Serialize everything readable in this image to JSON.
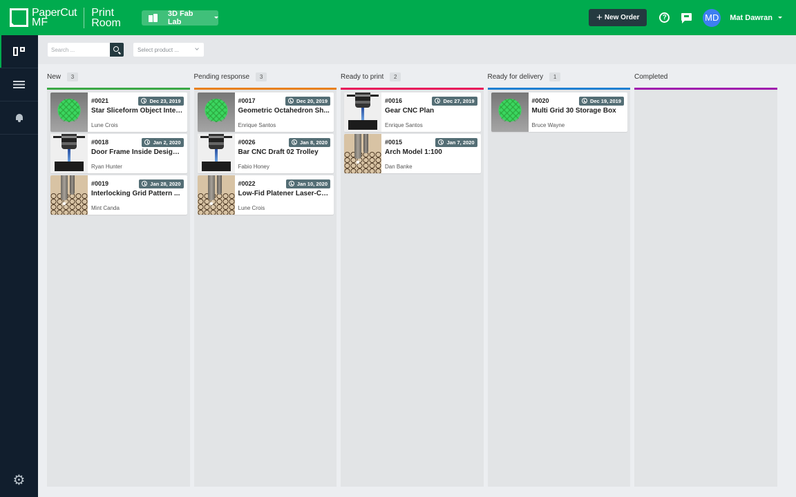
{
  "header": {
    "brand_line1": "PaperCut",
    "brand_line2": "MF",
    "product_line1": "Print",
    "product_line2": "Room",
    "lab_selector": "3D Fab Lab",
    "new_order_label": "New Order",
    "help_label": "?",
    "user_initials": "MD",
    "user_name": "Mat Dawran",
    "brand_color": "#00ab4e",
    "avatar_color": "#3d7ff0"
  },
  "sidebar": {
    "items": [
      {
        "icon": "board-icon",
        "active": true
      },
      {
        "icon": "list-icon",
        "active": false
      },
      {
        "icon": "bell-icon",
        "active": false
      }
    ],
    "footer_icon": "gear-icon",
    "gear_glyph": "⚙"
  },
  "filters": {
    "search_placeholder": "Search ...",
    "product_placeholder": "Select product ..."
  },
  "columns": [
    {
      "title": "New",
      "count": "3",
      "color": "#3aa845",
      "cards": [
        {
          "id": "#0021",
          "date": "Dec 23, 2019",
          "title": "Star Sliceform Object Inter...",
          "owner": "Lune Crois",
          "thumb": "green"
        },
        {
          "id": "#0018",
          "date": "Jan 2, 2020",
          "title": "Door Frame Inside Design ...",
          "owner": "Ryan Hunter",
          "thumb": "cnc"
        },
        {
          "id": "#0019",
          "date": "Jan 28, 2020",
          "title": "Interlocking Grid Pattern ...",
          "owner": "Mint Canda",
          "thumb": "laser"
        }
      ]
    },
    {
      "title": "Pending response",
      "count": "3",
      "color": "#e8801c",
      "cards": [
        {
          "id": "#0017",
          "date": "Dec 20, 2019",
          "title": "Geometric Octahedron Sh...",
          "owner": "Enrique Santos",
          "thumb": "green"
        },
        {
          "id": "#0026",
          "date": "Jan 8, 2020",
          "title": "Bar CNC Draft 02 Trolley",
          "owner": "Fabio Honey",
          "thumb": "cnc"
        },
        {
          "id": "#0022",
          "date": "Jan 10, 2020",
          "title": "Low-Fid Platener Laser-Cu...",
          "owner": "Lune Crois",
          "thumb": "laser"
        }
      ]
    },
    {
      "title": "Ready to print",
      "count": "2",
      "color": "#e8135a",
      "cards": [
        {
          "id": "#0016",
          "date": "Dec 27, 2019",
          "title": "Gear CNC Plan",
          "owner": "Enrique Santos",
          "thumb": "cnc"
        },
        {
          "id": "#0015",
          "date": "Jan 7, 2020",
          "title": "Arch Model 1:100",
          "owner": "Dan Banke",
          "thumb": "laser"
        }
      ]
    },
    {
      "title": "Ready for delivery",
      "count": "1",
      "color": "#1e7fd2",
      "cards": [
        {
          "id": "#0020",
          "date": "Dec 19, 2019",
          "title": "Multi Grid 30 Storage Box",
          "owner": "Bruce Wayne",
          "thumb": "green"
        }
      ]
    },
    {
      "title": "Completed",
      "count": null,
      "color": "#a01aae",
      "cards": []
    }
  ]
}
